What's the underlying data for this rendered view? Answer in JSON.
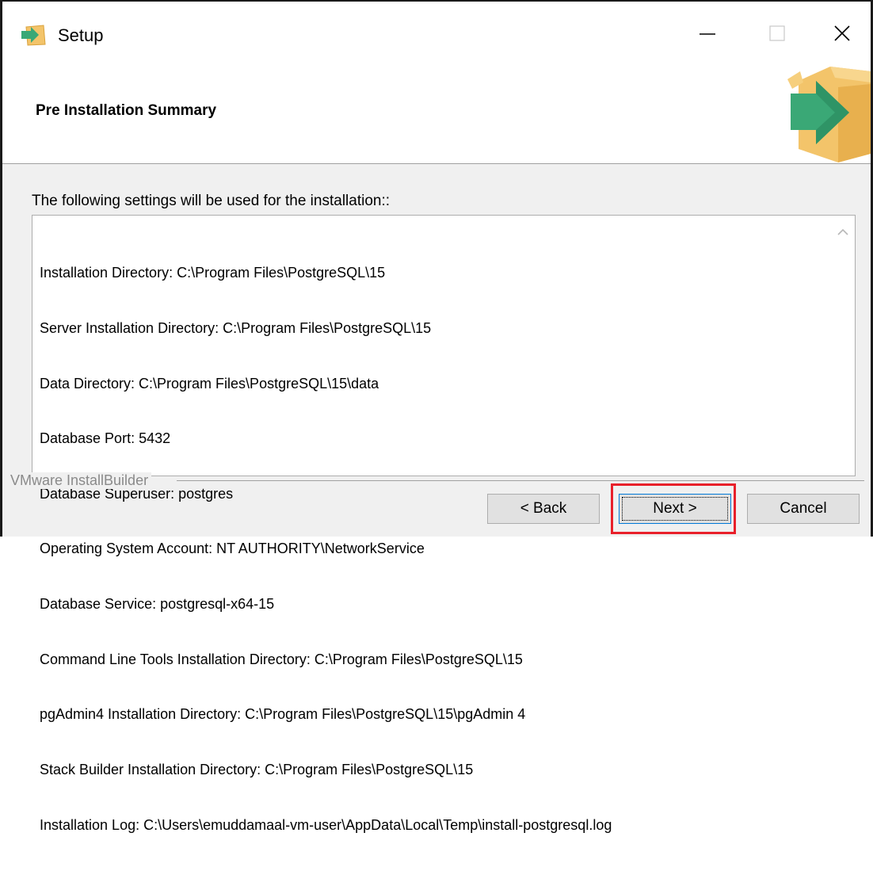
{
  "window": {
    "title": "Setup",
    "controls": {
      "minimize": "minimize",
      "maximize": "maximize",
      "close": "close"
    }
  },
  "header": {
    "title": "Pre Installation Summary"
  },
  "content": {
    "intro": "The following settings will be used for the installation::",
    "summary_lines": [
      "Installation Directory: C:\\Program Files\\PostgreSQL\\15",
      "Server Installation Directory: C:\\Program Files\\PostgreSQL\\15",
      "Data Directory: C:\\Program Files\\PostgreSQL\\15\\data",
      "Database Port: 5432",
      "Database Superuser: postgres",
      "Operating System Account: NT AUTHORITY\\NetworkService",
      "Database Service: postgresql-x64-15",
      "Command Line Tools Installation Directory: C:\\Program Files\\PostgreSQL\\15",
      "pgAdmin4 Installation Directory: C:\\Program Files\\PostgreSQL\\15\\pgAdmin 4",
      "Stack Builder Installation Directory: C:\\Program Files\\PostgreSQL\\15",
      "Installation Log: C:\\Users\\emuddamaal-vm-user\\AppData\\Local\\Temp\\install-postgresql.log"
    ]
  },
  "footer": {
    "brand": "VMware InstallBuilder",
    "back_label": "< Back",
    "next_label": "Next >",
    "cancel_label": "Cancel"
  },
  "colors": {
    "highlight": "#e8202a",
    "box_tan": "#f3c46a",
    "arrow_green": "#3aa876",
    "focus_blue": "#0078d7"
  },
  "icons": {
    "app": "installer-box-icon",
    "minimize": "minimize-icon",
    "maximize": "maximize-icon",
    "close": "close-icon",
    "scroll_up": "chevron-up-icon"
  }
}
